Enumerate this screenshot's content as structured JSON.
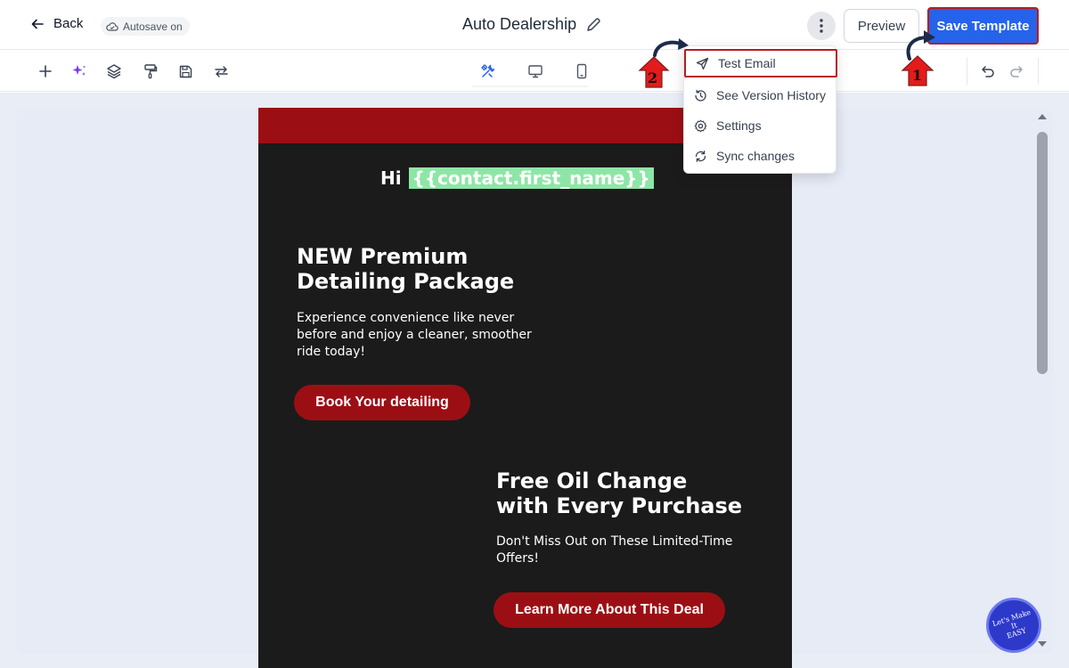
{
  "header": {
    "back_label": "Back",
    "autosave_label": "Autosave on",
    "title": "Auto Dealership",
    "preview_label": "Preview",
    "save_label": "Save Template"
  },
  "toolbar": {
    "tools": [
      "add-icon",
      "ai-sparkle-icon",
      "layers-icon",
      "paint-roller-icon",
      "save-icon",
      "swap-icon"
    ],
    "views": [
      "build-icon",
      "desktop-icon",
      "mobile-icon"
    ],
    "active_view": "build-icon",
    "history": [
      "undo-icon",
      "redo-icon"
    ]
  },
  "menu": {
    "items": [
      {
        "label": "Test Email",
        "icon": "send-icon",
        "highlighted": true
      },
      {
        "label": "See Version History",
        "icon": "history-icon"
      },
      {
        "label": "Settings",
        "icon": "settings-icon"
      },
      {
        "label": "Sync changes",
        "icon": "sync-icon"
      }
    ]
  },
  "annotations": {
    "step1": "1",
    "step2": "2",
    "highlight_color": "#b91c1c"
  },
  "email": {
    "greeting": "Hi",
    "merge_tag": "{{contact.first_name}}",
    "section1": {
      "heading_line1": "NEW Premium",
      "heading_line2": "Detailing Package",
      "body_line1": "Experience convenience like never",
      "body_line2": "before and enjoy a cleaner, smoother",
      "body_line3": "ride today!",
      "cta": "Book Your detailing"
    },
    "section2": {
      "heading_line1": "Free Oil Change",
      "heading_line2": "with Every Purchase",
      "body_line1": "Don't Miss Out on These Limited-Time",
      "body_line2": "Offers!",
      "cta": "Learn More About This Deal"
    }
  },
  "badge": {
    "text_line1": "Let's Make",
    "text_line2": "It",
    "text_line3": "EASY"
  },
  "colors": {
    "primary": "#2563eb",
    "email_red": "#9b0f14",
    "email_bg": "#1b1b1b",
    "merge_tag_bg": "#8ee6a6"
  }
}
